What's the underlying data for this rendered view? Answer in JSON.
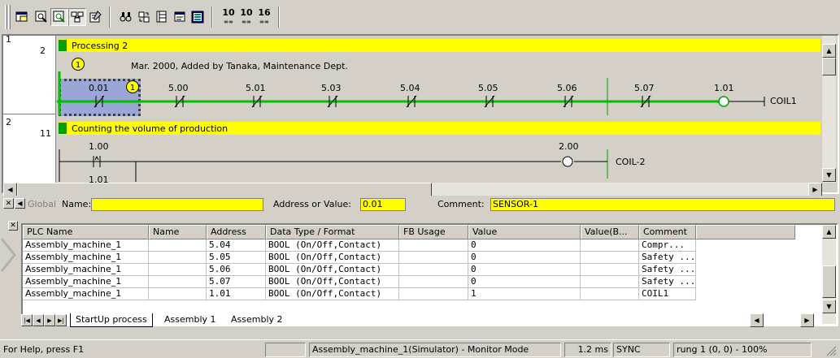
{
  "toolbar": {
    "icons": [
      "window-icon",
      "zoom-icon",
      "zoom-window-icon",
      "network-icon",
      "properties-icon",
      "find-icon",
      "replace-icon",
      "io-comment-icon",
      "rung-comment-icon",
      "memory-table-icon"
    ],
    "numeric_buttons": [
      "10",
      "10",
      "16"
    ]
  },
  "ladder": {
    "rung1": {
      "head": "1",
      "number": "2",
      "title": "Processing 2",
      "note_badge": "1",
      "note": "Mar. 2000, Added by Tanaka, Maintenance Dept.",
      "contact_badge": "1",
      "contacts": [
        "0.01",
        "5.00",
        "5.01",
        "5.03",
        "5.04",
        "5.05",
        "5.06",
        "5.07"
      ],
      "coil_address": "1.01",
      "coil_name": "COIL1"
    },
    "rung2": {
      "head": "2",
      "number": "11",
      "title": "Counting the volume of production",
      "contact1": "1.00",
      "contact2": "1.01",
      "coil_address": "2.00",
      "coil_name": "COIL-2"
    }
  },
  "fieldbar": {
    "global_label": "Global",
    "name_label": "Name:",
    "name_value": "",
    "address_label": "Address or Value:",
    "address_value": "0.01",
    "comment_label": "Comment:",
    "comment_value": "SENSOR-1"
  },
  "table": {
    "columns": [
      "PLC Name",
      "Name",
      "Address",
      "Data Type / Format",
      "FB Usage",
      "Value",
      "Value(B...",
      "Comment"
    ],
    "rows": [
      [
        "Assembly_machine_1",
        "",
        "5.04",
        "BOOL (On/Off,Contact)",
        "",
        "0",
        "",
        "Compr..."
      ],
      [
        "Assembly_machine_1",
        "",
        "5.05",
        "BOOL (On/Off,Contact)",
        "",
        "0",
        "",
        "Safety ..."
      ],
      [
        "Assembly_machine_1",
        "",
        "5.06",
        "BOOL (On/Off,Contact)",
        "",
        "0",
        "",
        "Safety ..."
      ],
      [
        "Assembly_machine_1",
        "",
        "5.07",
        "BOOL (On/Off,Contact)",
        "",
        "0",
        "",
        "Safety ..."
      ],
      [
        "Assembly_machine_1",
        "",
        "1.01",
        "BOOL (On/Off,Contact)",
        "",
        "1",
        "",
        "COIL1"
      ]
    ]
  },
  "tabs": [
    "StartUp process",
    "Assembly 1",
    "Assembly 2"
  ],
  "status": {
    "help": "For Help, press F1",
    "mode": "Assembly_machine_1(Simulator) - Monitor Mode",
    "cycle": "1.2 ms",
    "sync": "SYNC",
    "position": "rung 1 (0, 0) - 100%"
  },
  "colors": {
    "power_flow": "#00c000",
    "title_bar": "#ffff00",
    "selection": "#9aa6d6",
    "window": "#d4d0c8"
  }
}
